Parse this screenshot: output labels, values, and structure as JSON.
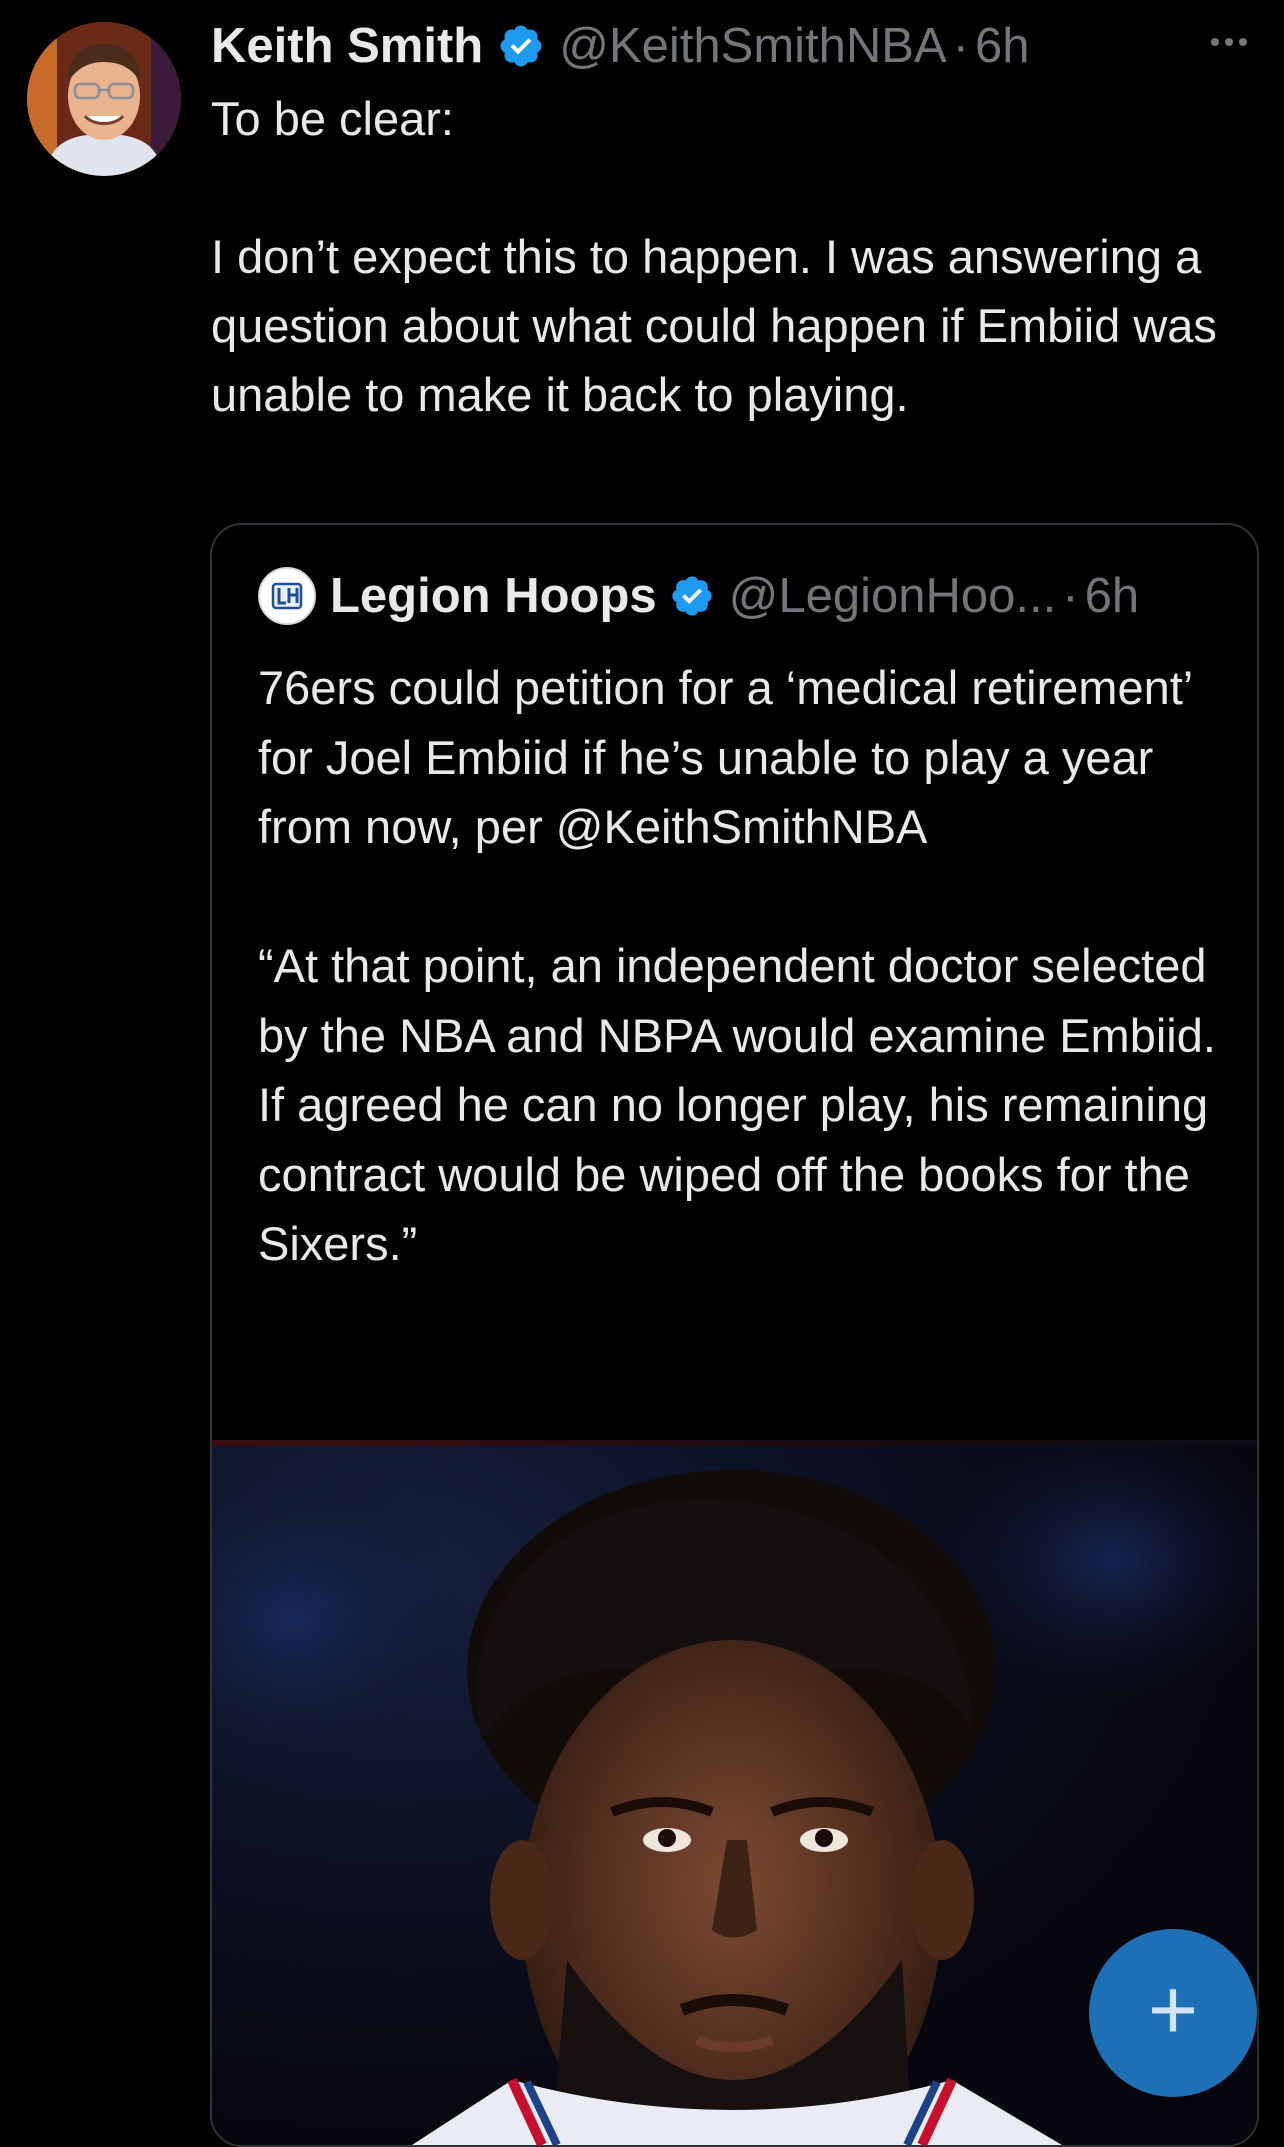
{
  "tweet": {
    "author_name": "Keith Smith",
    "author_handle": "@KeithSmithNBA",
    "separator": "·",
    "time": "6h",
    "text": "To be clear:\n\nI don’t expect this to happen. I was answering a question about what could happen if Embiid was unable to make it back to playing."
  },
  "quoted": {
    "author_name": "Legion Hoops",
    "author_handle": "@LegionHoo...",
    "separator": "·",
    "time": "6h",
    "text": "76ers could petition for a ‘medical retirement’ for Joel Embiid if he’s unable to play a year from now, per @KeithSmithNBA\n\n“At that point, an independent doctor selected by the NBA and NBPA would examine Embiid. If agreed he can no longer play, his remaining contract would be wiped off the books for the Sixers.”"
  },
  "icons": {
    "verified": "verified-badge-icon",
    "more": "more-options-icon",
    "compose": "compose-plus-icon"
  },
  "colors": {
    "background": "#000000",
    "text": "#e7e9ea",
    "muted": "#71767b",
    "verified": "#1d9bf0",
    "fab": "#1d70b5"
  }
}
